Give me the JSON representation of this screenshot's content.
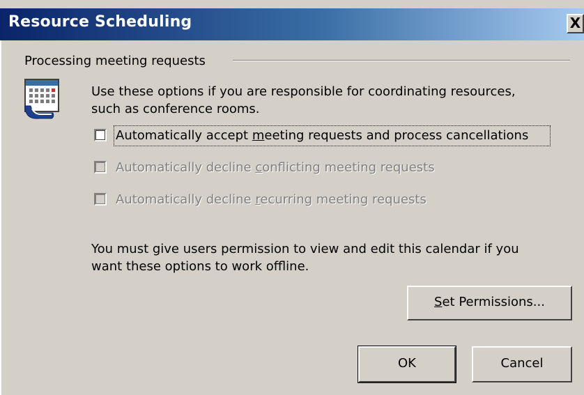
{
  "window": {
    "title": "Resource Scheduling",
    "close_glyph": "X"
  },
  "group": {
    "title": "Processing meeting requests"
  },
  "description": {
    "line1": "Use these options if you are responsible for coordinating resources,",
    "line2": "such as conference rooms."
  },
  "options": [
    {
      "pre": "Automatically accept ",
      "accel": "m",
      "post": "eeting requests and process cancellations",
      "checked": false,
      "enabled": true
    },
    {
      "pre": "Automatically decline ",
      "accel": "c",
      "post": "onflicting meeting requests",
      "checked": false,
      "enabled": false
    },
    {
      "pre": "Automatically decline ",
      "accel": "r",
      "post": "ecurring meeting requests",
      "checked": false,
      "enabled": false
    }
  ],
  "notice": {
    "line1": "You must give users permission to view and edit this calendar if you",
    "line2": "want these options to work offline."
  },
  "buttons": {
    "set_permissions": {
      "accel": "S",
      "rest": "et Permissions..."
    },
    "ok": "OK",
    "cancel": "Cancel"
  },
  "icons": {
    "calendar": "calendar-icon",
    "close": "close-icon"
  }
}
